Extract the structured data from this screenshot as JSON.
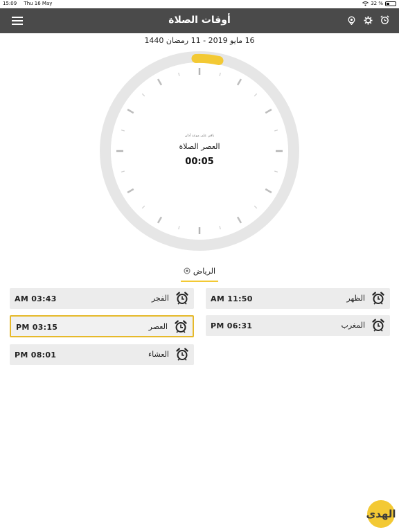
{
  "status": {
    "time": "15:09",
    "date": "Thu 16 May",
    "battery": "32 %",
    "battery_level": 0.32
  },
  "header": {
    "title": "أوقات الصلاة",
    "icons": [
      "menu-icon",
      "location-pin-icon",
      "settings-gear-icon",
      "alarm-clock-icon"
    ]
  },
  "date_line": "16 مايو 2019 - 11 رمضان 1440",
  "clock": {
    "subtitle": "باقي على موعد أذان",
    "prayer_name": "العصر الصلاة",
    "countdown": "00:05",
    "accent": "#f3c934",
    "ring": "#e6e6e6"
  },
  "location": {
    "city": "الرياض"
  },
  "prayers": [
    {
      "name": "الظهر",
      "time": "AM 11:50",
      "active": false
    },
    {
      "name": "الفجر",
      "time": "AM 03:43",
      "active": false
    },
    {
      "name": "المغرب",
      "time": "PM 06:31",
      "active": false
    },
    {
      "name": "العصر",
      "time": "PM 03:15",
      "active": true
    },
    {
      "name": "العشاء",
      "time": "PM 08:01",
      "active": false
    }
  ],
  "logo": {
    "text": "الهدى",
    "color": "#f3c934"
  }
}
